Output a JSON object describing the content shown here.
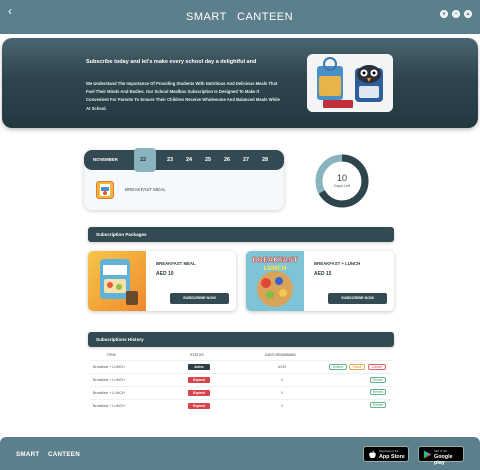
{
  "header": {
    "back_icon": "chevron-left-icon",
    "brand_left": "SMART",
    "brand_right": "CANTEEN",
    "icons": [
      "user-icon",
      "cart-icon",
      "profile-icon"
    ]
  },
  "hero": {
    "title": "Subscribe today and let's make every school day a delightful and",
    "line1": "We Understand The Importance Of Providing Students With Nutritious And Delicious Meals That",
    "line2": "Fuel Their Minds And Bodies. Our School Mealbox Subscription Is Designed To Make It",
    "line3": "Convenient For Parents To Ensure Their Children Receive Wholesome And Balanced Meals While",
    "line4": "At School."
  },
  "calendar": {
    "month": "NOVEMBER",
    "days": [
      "22",
      "23",
      "24",
      "25",
      "26",
      "27",
      "28"
    ],
    "selected_day": "22",
    "meal_label": "BREAKFAST MEAL"
  },
  "days_left": {
    "value": "10",
    "label": "Days Left",
    "fraction": 0.67
  },
  "packages": {
    "section_title": "Subscription Packages",
    "items": [
      {
        "name": "BREAKFAST MEAL",
        "price": "AED 10",
        "button": "SUBSCRIBE NOW"
      },
      {
        "name": "BREAKFAST + LUNCH",
        "price": "AED 15",
        "button": "SUBSCRIBE NOW",
        "image_text": "BREAKFAST LUNCH"
      }
    ]
  },
  "history": {
    "section_title": "Subscriptions History",
    "columns": [
      "ITEM",
      "STATUS",
      "DAYS REMAINING"
    ],
    "rows": [
      {
        "item": "Breakfast + LUNCH",
        "status": "Active",
        "days": "5/125",
        "actions": [
          "Extend",
          "Pause",
          "Cancel"
        ]
      },
      {
        "item": "Breakfast + LUNCH",
        "status": "Expired",
        "days": "0",
        "actions": [
          "Renew"
        ]
      },
      {
        "item": "Breakfast + LUNCH",
        "status": "Expired",
        "days": "0",
        "actions": [
          "Renew"
        ]
      },
      {
        "item": "Breakfast + LUNCH",
        "status": "Expired",
        "days": "0",
        "actions": [
          "Renew"
        ]
      }
    ]
  },
  "footer": {
    "brand_left": "SMART",
    "brand_right": "CANTEEN",
    "app_store_small": "Download on the",
    "app_store": "App Store",
    "google_play_small": "GET IT ON",
    "google_play": "Google play"
  },
  "colors": {
    "header": "#5c7f8c",
    "dark": "#344a53",
    "accent": "#8ab3c0",
    "active": "#2d3d44",
    "expired": "#d9434b"
  }
}
